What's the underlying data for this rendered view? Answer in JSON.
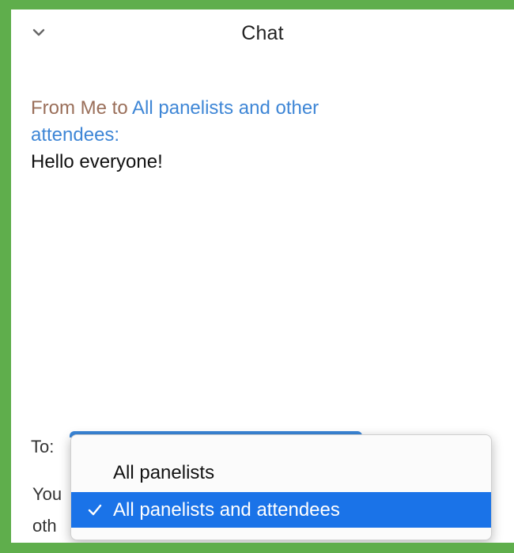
{
  "header": {
    "title": "Chat",
    "collapse_icon": "chevron-down-icon"
  },
  "message": {
    "from_prefix": "From Me to ",
    "recipient": "All panelists and other attendees:",
    "text": "Hello everyone!"
  },
  "composer": {
    "to_label": "To:",
    "behind_line_1": "You",
    "behind_line_2": "oth"
  },
  "dropdown": {
    "options": [
      {
        "label": "All panelists",
        "selected": false
      },
      {
        "label": "All panelists and attendees",
        "selected": true
      }
    ],
    "selected_color": "#1a73e8"
  },
  "colors": {
    "frame": "#5fae4c",
    "link": "#3e86d6",
    "sender": "#9a6f5a"
  }
}
